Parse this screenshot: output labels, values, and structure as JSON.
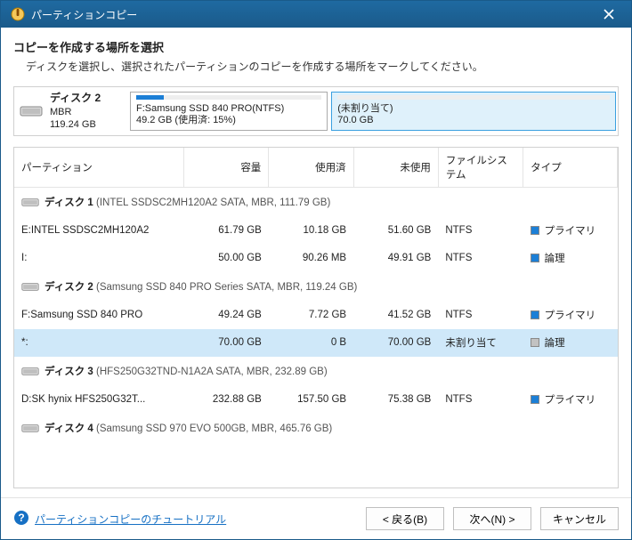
{
  "window": {
    "title": "パーティションコピー"
  },
  "header": {
    "heading": "コピーを作成する場所を選択",
    "subheading": "ディスクを選択し、選択されたパーティションのコピーを作成する場所をマークしてください。"
  },
  "summary": {
    "disk_label": "ディスク 2",
    "scheme": "MBR",
    "size": "119.24 GB",
    "blocks": [
      {
        "label_line1": "F:Samsung SSD 840 PRO(NTFS)",
        "label_line2": "49.2 GB (使用済: 15%)",
        "usage_pct": 15,
        "selected": false,
        "width_pct": 41
      },
      {
        "label_line1": "(未割り当て)",
        "label_line2": "70.0 GB",
        "usage_pct": 0,
        "selected": true,
        "width_pct": 59
      }
    ]
  },
  "table": {
    "columns": {
      "partition": "パーティション",
      "capacity": "容量",
      "used": "使用済",
      "free": "未使用",
      "fs": "ファイルシステム",
      "type": "タイプ"
    },
    "groups": [
      {
        "title": "ディスク 1",
        "subtitle": "(INTEL SSDSC2MH120A2 SATA, MBR, 111.79 GB)",
        "rows": [
          {
            "name": "E:INTEL SSDSC2MH120A2",
            "cap": "61.79 GB",
            "used": "10.18 GB",
            "free": "51.60 GB",
            "fs": "NTFS",
            "type": "プライマリ",
            "sw": "blue",
            "selected": false
          },
          {
            "name": "I:",
            "cap": "50.00 GB",
            "used": "90.26 MB",
            "free": "49.91 GB",
            "fs": "NTFS",
            "type": "論理",
            "sw": "blue",
            "selected": false
          }
        ]
      },
      {
        "title": "ディスク 2",
        "subtitle": "(Samsung SSD 840 PRO Series SATA, MBR, 119.24 GB)",
        "rows": [
          {
            "name": "F:Samsung SSD 840 PRO",
            "cap": "49.24 GB",
            "used": "7.72 GB",
            "free": "41.52 GB",
            "fs": "NTFS",
            "type": "プライマリ",
            "sw": "blue",
            "selected": false
          },
          {
            "name": "*:",
            "cap": "70.00 GB",
            "used": "0 B",
            "free": "70.00 GB",
            "fs": "未割り当て",
            "type": "論理",
            "sw": "gray",
            "selected": true
          }
        ]
      },
      {
        "title": "ディスク 3",
        "subtitle": "(HFS250G32TND-N1A2A SATA, MBR, 232.89 GB)",
        "rows": [
          {
            "name": "D:SK hynix HFS250G32T...",
            "cap": "232.88 GB",
            "used": "157.50 GB",
            "free": "75.38 GB",
            "fs": "NTFS",
            "type": "プライマリ",
            "sw": "blue",
            "selected": false
          }
        ]
      },
      {
        "title": "ディスク 4",
        "subtitle": "(Samsung SSD 970 EVO 500GB, MBR, 465.76 GB)",
        "rows": []
      }
    ]
  },
  "footer": {
    "tutorial": "パーティションコピーのチュートリアル",
    "back": "< 戻る(B)",
    "next": "次へ(N) >",
    "cancel": "キャンセル"
  }
}
